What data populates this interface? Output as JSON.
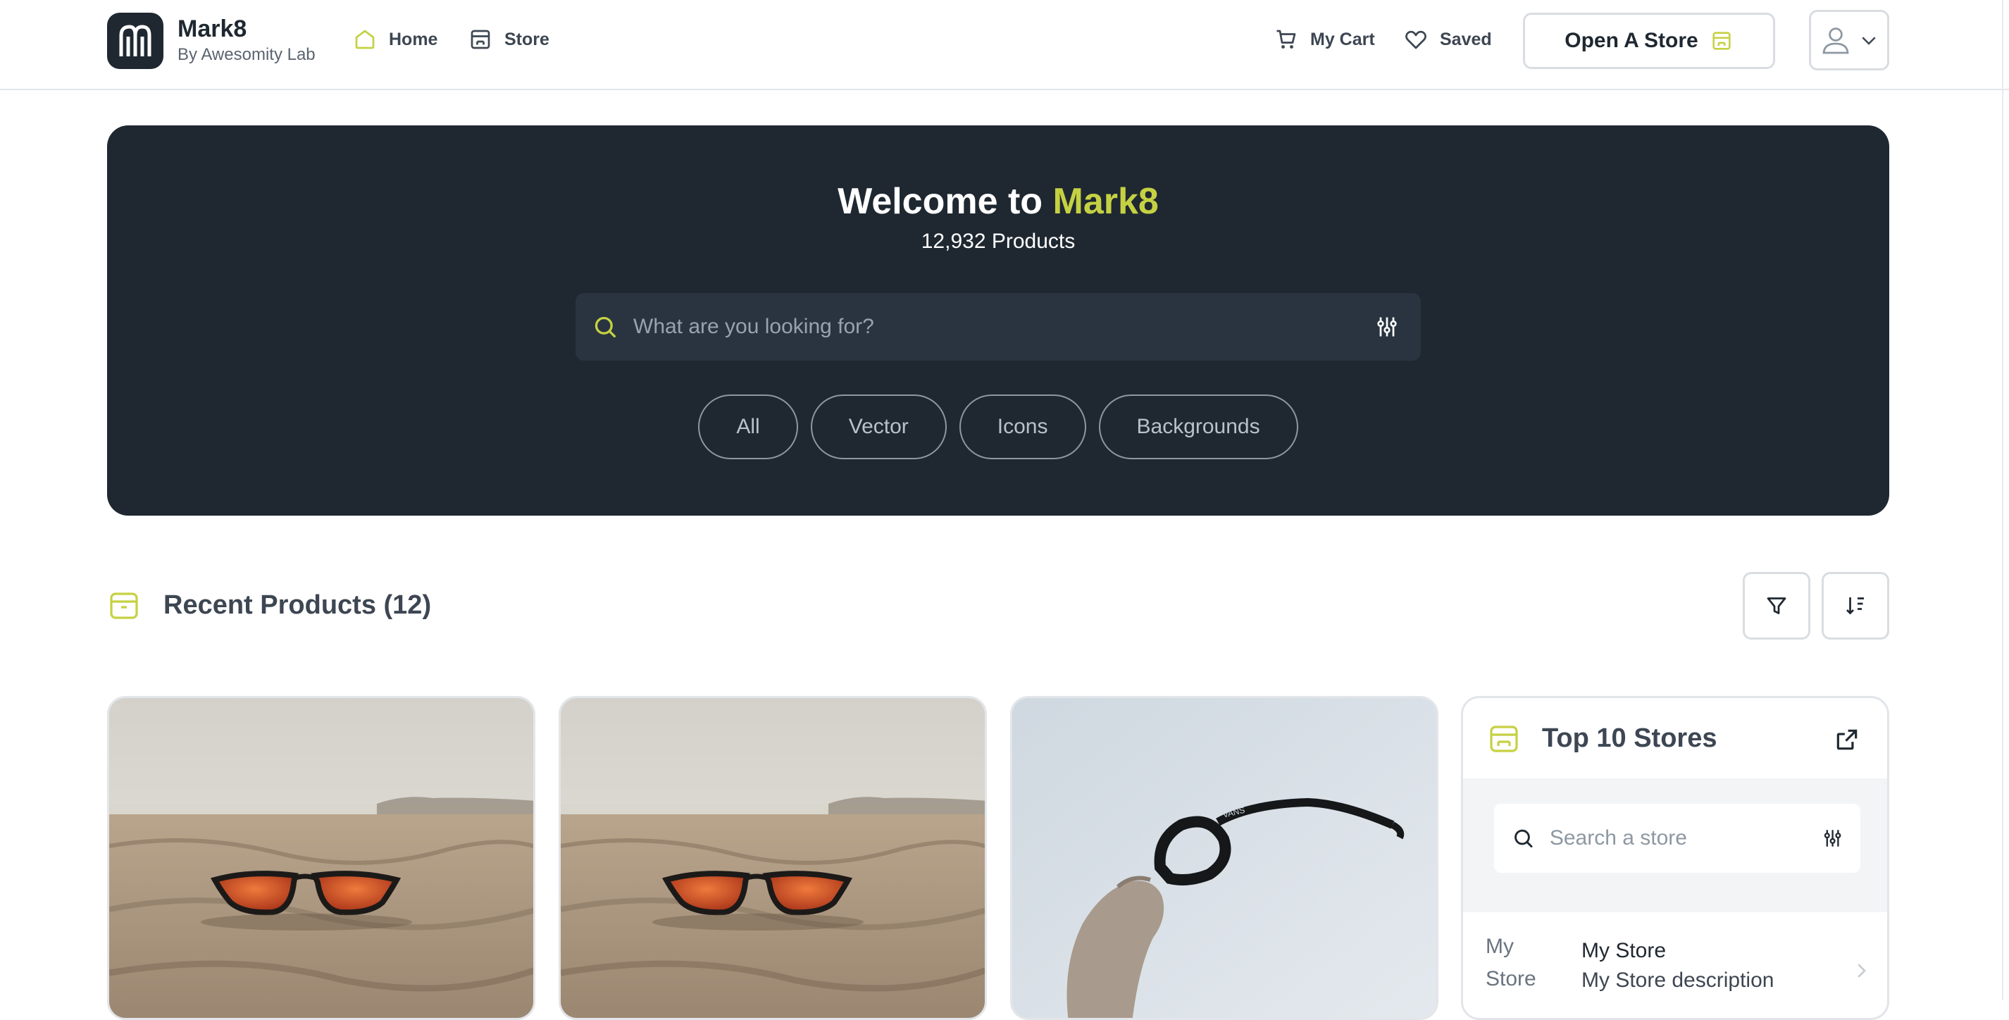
{
  "header": {
    "brand_name": "Mark8",
    "brand_sub": "By Awesomity Lab",
    "nav": [
      {
        "label": "Home",
        "icon": "home-icon",
        "active": true
      },
      {
        "label": "Store",
        "icon": "store-icon"
      }
    ],
    "cart_label": "My Cart",
    "saved_label": "Saved",
    "open_store_label": "Open A Store"
  },
  "hero": {
    "title_prefix": "Welcome to",
    "title_accent": "Mark8",
    "product_count": "12,932 Products",
    "search_placeholder": "What are you looking for?",
    "chips": [
      "All",
      "Vector",
      "Icons",
      "Backgrounds"
    ]
  },
  "recent": {
    "title": "Recent Products (12)",
    "products": [
      {
        "image": "sunglasses-on-sand"
      },
      {
        "image": "sunglasses-on-sand"
      },
      {
        "image": "hand-holding-glasses"
      }
    ]
  },
  "stores": {
    "title": "Top 10 Stores",
    "search_placeholder": "Search a store",
    "items": [
      {
        "image_alt": "My Store",
        "name": "My Store",
        "description": "My Store description"
      }
    ]
  },
  "colors": {
    "dark": "#1f2831",
    "accent": "#c5d142",
    "border": "#d9dde2"
  }
}
